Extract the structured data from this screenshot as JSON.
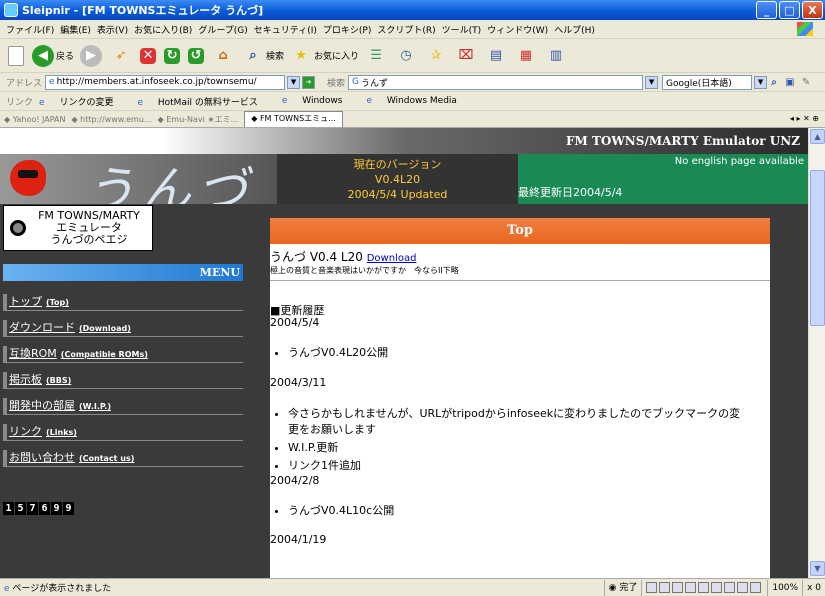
{
  "window": {
    "title": "Sleipnir - [FM TOWNSエミュレータ うんづ]",
    "min": "_",
    "max": "□",
    "close": "X"
  },
  "menubar": [
    "ファイル(F)",
    "編集(E)",
    "表示(V)",
    "お気に入り(B)",
    "グループ(G)",
    "セキュリティ(I)",
    "プロキシ(P)",
    "スクリプト(R)",
    "ツール(T)",
    "ウィンドウ(W)",
    "ヘルプ(H)"
  ],
  "toolbar": {
    "back": "戻る",
    "search": "検索",
    "favorites": "お気に入り"
  },
  "address": {
    "label": "アドレス",
    "url": "http://members.at.infoseek.co.jp/townsemu/",
    "search_label": "検索",
    "search_value": "うんず",
    "engine": "Google(日本語)"
  },
  "links": {
    "label": "リンク",
    "items": [
      "リンクの変更",
      "HotMail の無料サービス",
      "Windows",
      "Windows Media"
    ]
  },
  "tabs": [
    {
      "label": "Yahoo! JAPAN",
      "active": false
    },
    {
      "label": "http://www.emu...",
      "active": false
    },
    {
      "label": "Emu-Navi ★エミ...",
      "active": false
    },
    {
      "label": "FM TOWNSエミュ...",
      "active": true
    }
  ],
  "tab_controls": "◂ ▸ ✕ ⊕",
  "page": {
    "banner": "FM TOWNS/MARTY Emulator UNZ",
    "logo_text": "うんづ",
    "version_title": "現在のバージョン",
    "version": "V0.4L20",
    "version_date": "2004/5/4 Updated",
    "no_english": "No english page available",
    "last_updated": "最終更新日2004/5/4",
    "sidebar_header": [
      "FM TOWNS/MARTY",
      "エミュレータ",
      "うんづのペエジ"
    ],
    "menu_title": "MENU",
    "menu": [
      {
        "jp": "トップ",
        "en": "(Top)"
      },
      {
        "jp": "ダウンロード",
        "en": "(Download)"
      },
      {
        "jp": "互換ROM",
        "en": "(Compatible ROMs)"
      },
      {
        "jp": "掲示板",
        "en": "(BBS)"
      },
      {
        "jp": "開発中の部屋",
        "en": "(W.I.P.)"
      },
      {
        "jp": "リンク",
        "en": "(Links)"
      },
      {
        "jp": "お問い合わせ",
        "en": "(Contact us)"
      }
    ],
    "counter": [
      "1",
      "5",
      "7",
      "6",
      "9",
      "9"
    ],
    "top_heading": "Top",
    "product": "うんづ V0.4 L20",
    "download_link": "Download",
    "tagline": "極上の音質と音楽表現はいかがですか　今ならII下略",
    "history_title": "■更新履歴",
    "history": [
      {
        "date": "2004/5/4",
        "items": [
          "うんづV0.4L20公開"
        ]
      },
      {
        "date": "2004/3/11",
        "items": [
          "今さらかもしれませんが、URLがtripodからinfoseekに変わりましたのでブックマークの変",
          "更をお願いします",
          "W.I.P.更新",
          "リンク1件追加"
        ]
      },
      {
        "date": "2004/2/8",
        "items": [
          "うんづV0.4L10c公開"
        ]
      },
      {
        "date": "2004/1/19",
        "items": []
      }
    ]
  },
  "status": {
    "text": "ページが表示されました",
    "done": "完了",
    "zoom": "100%",
    "close": "x 0"
  }
}
